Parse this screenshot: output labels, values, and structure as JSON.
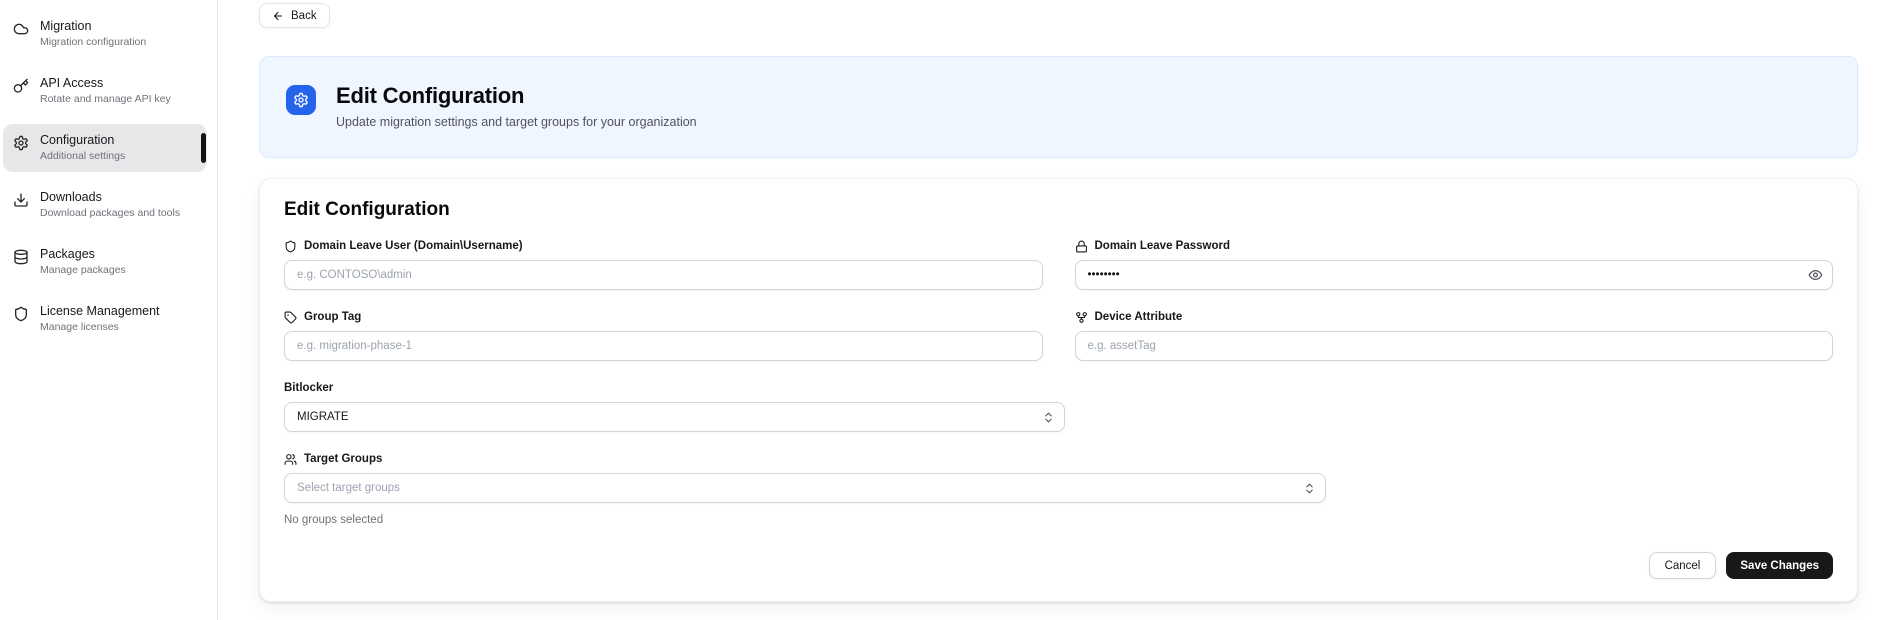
{
  "sidebar": {
    "items": [
      {
        "label": "Migration",
        "description": "Migration configuration",
        "icon": "cloud-icon",
        "selected": false
      },
      {
        "label": "API Access",
        "description": "Rotate and manage API key",
        "icon": "key-icon",
        "selected": false
      },
      {
        "label": "Configuration",
        "description": "Additional settings",
        "icon": "gear-icon",
        "selected": true
      },
      {
        "label": "Downloads",
        "description": "Download packages and tools",
        "icon": "download-icon",
        "selected": false
      },
      {
        "label": "Packages",
        "description": "Manage packages",
        "icon": "database-icon",
        "selected": false
      },
      {
        "label": "License Management",
        "description": "Manage licenses",
        "icon": "shield-icon",
        "selected": false
      }
    ]
  },
  "header": {
    "back_label": "Back",
    "banner": {
      "icon": "gear-icon",
      "title": "Edit Configuration",
      "subtitle": "Update migration settings and target groups for your organization"
    }
  },
  "form": {
    "title": "Edit Configuration",
    "fields": {
      "domain_leave_user": {
        "icon": "shield-icon",
        "label": "Domain Leave User (Domain\\Username)",
        "placeholder": "e.g. CONTOSO\\admin",
        "value": ""
      },
      "domain_leave_password": {
        "icon": "lock-icon",
        "label": "Domain Leave Password",
        "value": "••••••••",
        "toggle_icon": "eye-icon"
      },
      "group_tag": {
        "icon": "tag-icon",
        "label": "Group Tag",
        "placeholder": "e.g. migration-phase-1",
        "value": ""
      },
      "device_attribute": {
        "icon": "git-fork-icon",
        "label": "Device Attribute",
        "placeholder": "e.g. assetTag",
        "value": ""
      },
      "bitlocker": {
        "label": "Bitlocker",
        "selected_option": "MIGRATE"
      },
      "target_groups": {
        "icon": "users-icon",
        "label": "Target Groups",
        "placeholder_option": "Select target groups",
        "empty_text": "No groups selected"
      }
    },
    "actions": {
      "cancel_label": "Cancel",
      "save_label": "Save Changes"
    }
  },
  "colors": {
    "accent_blue": "#2563eb",
    "banner_bg": "#eff6ff",
    "banner_border": "#dbeafe",
    "save_button_bg": "#18181b",
    "selected_nav_bg": "#e7e7e9",
    "input_border": "#d4d4d8",
    "muted_text": "#71717a"
  }
}
